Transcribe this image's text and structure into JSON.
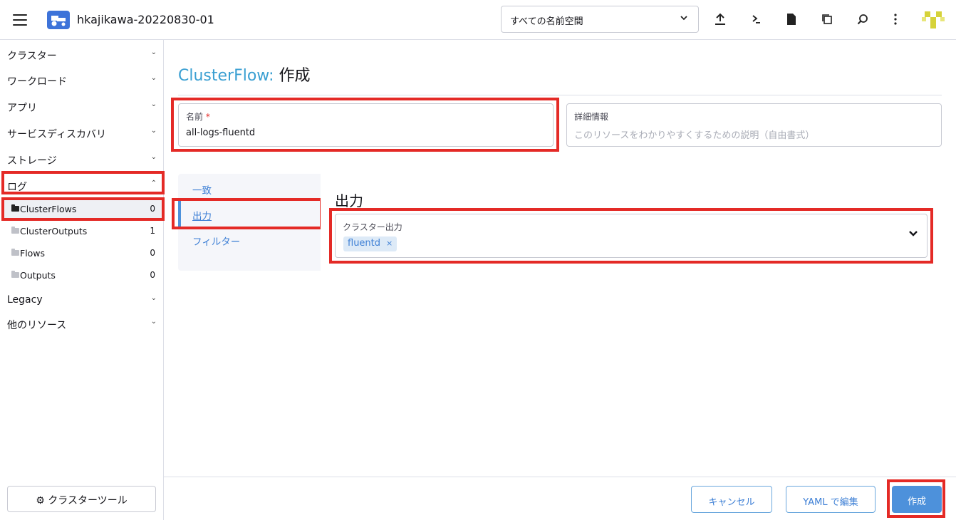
{
  "header": {
    "cluster_name": "hkajikawa-20220830-01",
    "namespace_select": "すべての名前空間",
    "icons": [
      "hamburger-icon",
      "cluster-logo-icon",
      "upload-icon",
      "terminal-icon",
      "file-icon",
      "copy-icon",
      "search-icon",
      "more-icon"
    ]
  },
  "sidebar": {
    "groups": [
      {
        "label": "クラスター"
      },
      {
        "label": "ワークロード"
      },
      {
        "label": "アプリ"
      },
      {
        "label": "サービスディスカバリ"
      },
      {
        "label": "ストレージ"
      },
      {
        "label": "ログ"
      }
    ],
    "sub_items": [
      {
        "label": "ClusterFlows",
        "count": "0"
      },
      {
        "label": "ClusterOutputs",
        "count": "1"
      },
      {
        "label": "Flows",
        "count": "0"
      },
      {
        "label": "Outputs",
        "count": "0"
      }
    ],
    "groups_after": [
      {
        "label": "Legacy"
      },
      {
        "label": "他のリソース"
      }
    ],
    "tools_button": "クラスターツール"
  },
  "main": {
    "title_type": "ClusterFlow:",
    "title_action": "作成",
    "name_field": {
      "label": "名前",
      "required_mark": "*",
      "value": "all-logs-fluentd"
    },
    "description_field": {
      "label": "詳細情報",
      "placeholder": "このリソースをわかりやすくするための説明（自由書式）"
    },
    "tabs": [
      {
        "label": "一致"
      },
      {
        "label": "出力"
      },
      {
        "label": "フィルター"
      }
    ],
    "panel_title": "出力",
    "cluster_output": {
      "label": "クラスター出力",
      "chips": [
        "fluentd"
      ],
      "remove_glyph": "×"
    }
  },
  "footer": {
    "cancel": "キャンセル",
    "edit_yaml": "YAML で編集",
    "create": "作成"
  },
  "colors": {
    "accent": "#3a9fd2",
    "primary_button": "#4d91db",
    "highlight_box": "#e42a26"
  }
}
